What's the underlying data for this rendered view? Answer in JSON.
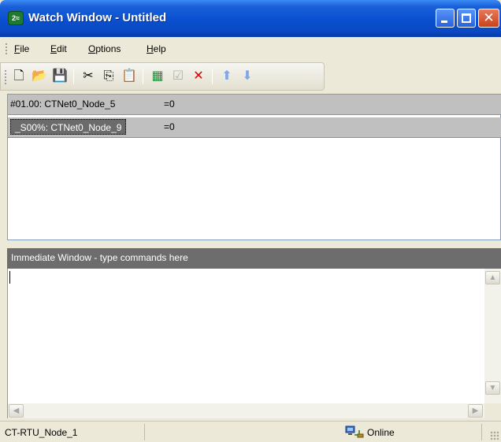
{
  "window": {
    "title": "Watch Window - Untitled",
    "icon": "app-icon"
  },
  "menu": [
    {
      "label": "File",
      "accel": "F",
      "rest": "ile"
    },
    {
      "label": "Edit",
      "accel": "E",
      "rest": "dit"
    },
    {
      "label": "Options",
      "accel": "O",
      "rest": "ptions"
    },
    {
      "label": "Help",
      "accel": "H",
      "rest": "elp"
    }
  ],
  "toolbar": {
    "buttons": [
      "new-icon",
      "open-icon",
      "save-icon",
      "cut-icon",
      "copy-icon",
      "paste-icon",
      "add-watch-icon",
      "properties-icon",
      "delete-icon",
      "move-up-icon",
      "move-down-icon"
    ]
  },
  "watch": {
    "rows": [
      {
        "name": "#01.00: CTNet0_Node_5",
        "value": "=0",
        "selected": false
      },
      {
        "name": "_S00%: CTNet0_Node_9",
        "value": "=0",
        "selected": true
      }
    ]
  },
  "immediate": {
    "header": "Immediate Window - type commands here",
    "content": ""
  },
  "status": {
    "node": "CT-RTU_Node_1",
    "connection": "Online"
  },
  "colors": {
    "titlebar": "#0a4fd0",
    "row_bg": "#c0c0c0",
    "selected_bg": "#6b6b6b",
    "immediate_header": "#6d6d6d"
  }
}
